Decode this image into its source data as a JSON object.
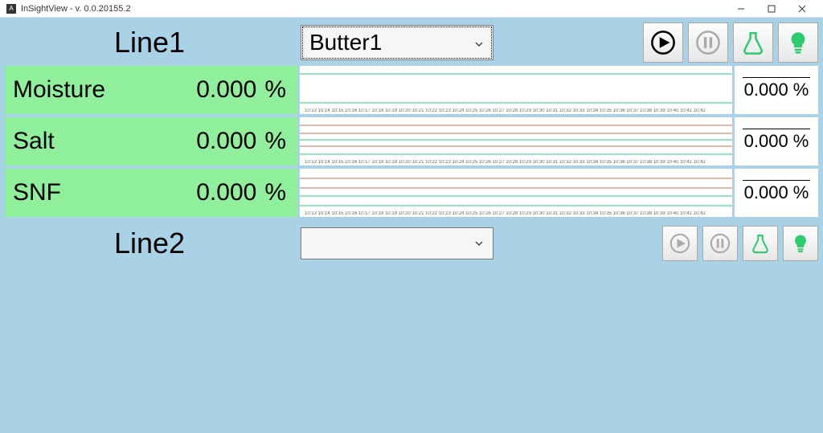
{
  "window": {
    "title": "InSightView - v. 0.0.20155.2",
    "appIcon": "A"
  },
  "line1": {
    "title": "Line1",
    "product": "Butter1",
    "params": [
      {
        "name": "Moisture",
        "value": "0.000",
        "unit": "%",
        "right": "0.000 %"
      },
      {
        "name": "Salt",
        "value": "0.000",
        "unit": "%",
        "right": "0.000 %"
      },
      {
        "name": "SNF",
        "value": "0.000",
        "unit": "%",
        "right": "0.000 %"
      }
    ],
    "chart_times": "10:13 10:14 10:15 10:16 10:17 10:18 10:19 10:20 10:21 10:22 10:23 10:24 10:25 10:26 10:27 10:28 10:29 10:30 10:31 10:32 10:33 10:34 10:35 10:36 10:37 10:38 10:39 10:40 10:41 10:42"
  },
  "line2": {
    "title": "Line2",
    "product": ""
  }
}
